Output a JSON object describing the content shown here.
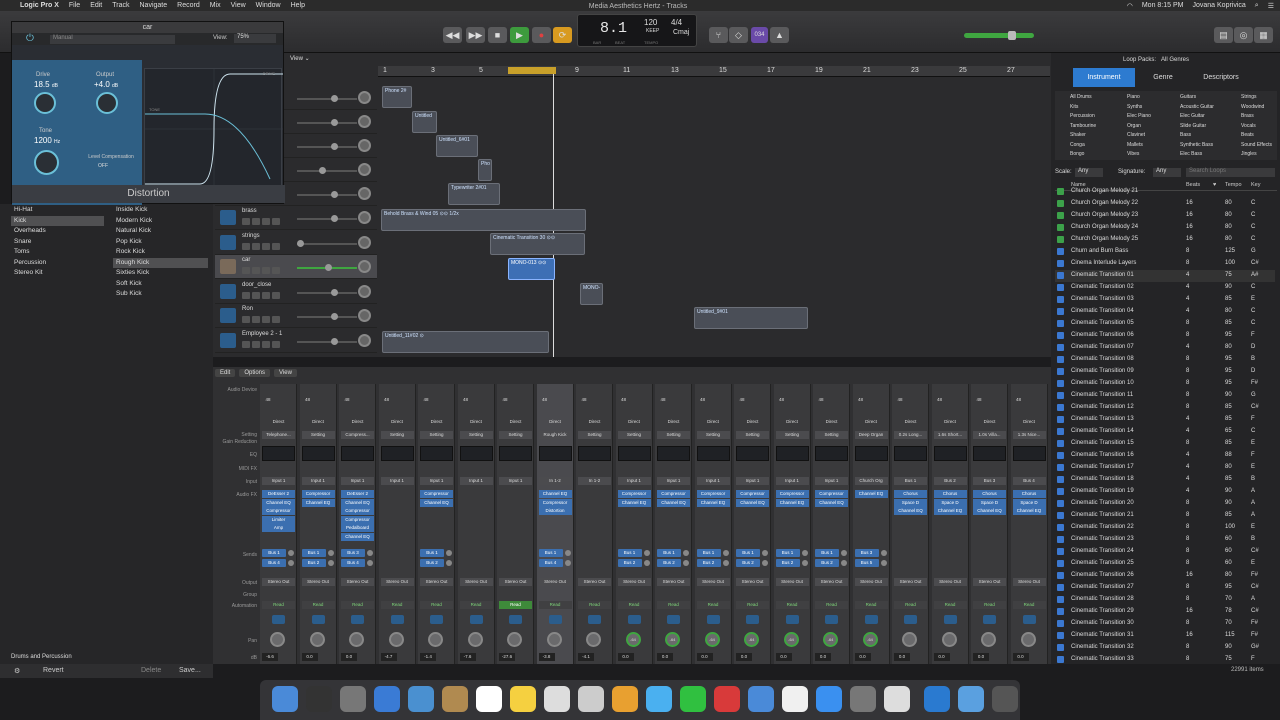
{
  "menubar": {
    "app": "Logic Pro X",
    "items": [
      "File",
      "Edit",
      "Track",
      "Navigate",
      "Record",
      "Mix",
      "View",
      "Window",
      "Help"
    ],
    "clock": "Mon 8:15 PM",
    "user": "Jovana Koprivica"
  },
  "lcd": {
    "title": "Media Aesthetics Hertz - Tracks",
    "position": "8.1",
    "tempo": "120",
    "tempo_sub": "KEEP",
    "signature": "4/4",
    "key": "Cmaj",
    "labels": [
      "BAR",
      "BEAT",
      "TEMPO"
    ]
  },
  "transport": {
    "rewind": "◀◀",
    "forward": "▶▶",
    "stop": "■",
    "play": "▶",
    "record": "●",
    "cycle": "⟳"
  },
  "toolbar_right": {
    "count": "034"
  },
  "plugin": {
    "title": "car",
    "preset": "Manual",
    "view_label": "View:",
    "view_value": "75%",
    "drive_label": "Drive",
    "drive_value": "18.5",
    "drive_unit": "dB",
    "output_label": "Output",
    "output_value": "+4.0",
    "output_unit": "dB",
    "tone_label": "Tone",
    "tone_value": "1200",
    "tone_unit": "Hz",
    "level_comp_label": "Level Compensation",
    "level_comp_value": "OFF",
    "graph_drive": "DRIVE",
    "graph_tone": "TONE",
    "name": "Distortion"
  },
  "tracks_toolbar": {
    "view": "View"
  },
  "ruler": [
    {
      "n": "1"
    },
    {
      "n": "3"
    },
    {
      "n": "5"
    },
    {
      "n": "7"
    },
    {
      "n": "9"
    },
    {
      "n": "11"
    },
    {
      "n": "13"
    },
    {
      "n": "15"
    },
    {
      "n": "17"
    },
    {
      "n": "19"
    },
    {
      "n": "21"
    },
    {
      "n": "23"
    },
    {
      "n": "25"
    },
    {
      "n": "27"
    }
  ],
  "tracks": [
    {
      "name": "",
      "pan": 0
    },
    {
      "name": "",
      "pan": 0
    },
    {
      "name": "",
      "pan": 0
    },
    {
      "name": "",
      "pan": 0
    },
    {
      "name": "",
      "pan": 0
    },
    {
      "name": "brass"
    },
    {
      "name": "strings"
    },
    {
      "name": "car"
    },
    {
      "name": "door_close"
    },
    {
      "name": "Ron"
    },
    {
      "name": "Employee 2 - 1"
    }
  ],
  "regions": [
    "Phone 2#",
    "Untitled",
    "Untitled_6#01",
    "Pho",
    "Typewriter 2#01",
    "Behold Brass & Wind 05 ⊙⊙ 1/2x",
    "Cinematic Transition 30 ⊙⊙",
    "MONO-013 ⊙⊙",
    "MONO-",
    "Untitled_9#01",
    "Untitled_11#02 ⊙"
  ],
  "library": {
    "col1": [
      "Hi-Hat",
      "Kick",
      "Overheads",
      "Snare",
      "Toms",
      "Percussion",
      "Stereo Kit"
    ],
    "col2": [
      "Inside Kick",
      "Modern Kick",
      "Natural Kick",
      "Pop Kick",
      "Rock Kick",
      "Rough Kick",
      "Sixties Kick",
      "Soft Kick",
      "Sub Kick"
    ],
    "footer": "Drums and Percussion",
    "revert": "Revert",
    "delete": "Delete",
    "save": "Save..."
  },
  "mixer": {
    "menu": [
      "Edit",
      "Options",
      "View"
    ],
    "row_labels": [
      "Audio Device",
      "Setting",
      "Gain Reduction",
      "EQ",
      "MIDI FX",
      "Input",
      "Audio FX",
      "Sends",
      "Output",
      "Group",
      "Automation",
      "Pan",
      "dB"
    ],
    "strips": [
      {
        "setting": "Telephone...",
        "input": "Input 1",
        "fx": [
          "DeEsser 2",
          "Channel EQ",
          "Compressor",
          "Limiter",
          "Amp"
        ],
        "sends": [
          "Bus 1",
          "Bus 4"
        ],
        "output": "Stereo Out",
        "auto": "Read",
        "db": "-6.6"
      },
      {
        "setting": "Setting",
        "input": "Input 1",
        "fx": [
          "Compressor",
          "Channel EQ"
        ],
        "sends": [
          "Bus 1",
          "Bus 2"
        ],
        "output": "Stereo Out",
        "auto": "Read",
        "db": "0.0"
      },
      {
        "setting": "Compress...",
        "input": "Input 1",
        "fx": [
          "DeEsser 2",
          "Channel EQ",
          "Compressor",
          "Compressor",
          "Pedalboard",
          "Channel EQ"
        ],
        "sends": [
          "Bus 3",
          "Bus 4"
        ],
        "output": "Stereo Out",
        "auto": "Read",
        "db": "0.0"
      },
      {
        "setting": "Setting",
        "input": "Input 1",
        "fx": [],
        "sends": [],
        "output": "Stereo Out",
        "auto": "Read",
        "db": "-4.7"
      },
      {
        "setting": "Setting",
        "input": "Input 1",
        "fx": [
          "Compressor",
          "Channel EQ"
        ],
        "sends": [
          "Bus 1",
          "Bus 2"
        ],
        "output": "Stereo Out",
        "auto": "Read",
        "db": "-1.4"
      },
      {
        "setting": "Setting",
        "input": "Input 1",
        "fx": [],
        "sends": [],
        "output": "Stereo Out",
        "auto": "Read",
        "db": "-7.6"
      },
      {
        "setting": "Setting",
        "input": "Input 1",
        "fx": [],
        "sends": [],
        "output": "Stereo Out",
        "auto": "Read",
        "db": "-27.6"
      },
      {
        "setting": "Rough Kick",
        "input": "In 1-2",
        "fx": [
          "Channel EQ",
          "Compressor",
          "Distortion"
        ],
        "sends": [
          "Bus 1",
          "Bus 4"
        ],
        "output": "Stereo Out",
        "auto": "Read",
        "db": "-3.8"
      },
      {
        "setting": "Setting",
        "input": "In 1-2",
        "fx": [],
        "sends": [],
        "output": "Stereo Out",
        "auto": "Read",
        "db": "-4.1"
      },
      {
        "setting": "Setting",
        "input": "Input 1",
        "fx": [
          "Compressor",
          "Channel EQ"
        ],
        "sends": [
          "Bus 1",
          "Bus 2"
        ],
        "output": "Stereo Out",
        "auto": "Read",
        "db": "0.0"
      },
      {
        "setting": "Setting",
        "input": "Input 1",
        "fx": [
          "Compressor",
          "Channel EQ"
        ],
        "sends": [
          "Bus 1",
          "Bus 2"
        ],
        "output": "Stereo Out",
        "auto": "Read",
        "db": "0.0"
      },
      {
        "setting": "Setting",
        "input": "Input 1",
        "fx": [
          "Compressor",
          "Channel EQ"
        ],
        "sends": [
          "Bus 1",
          "Bus 2"
        ],
        "output": "Stereo Out",
        "auto": "Read",
        "db": "0.0"
      },
      {
        "setting": "Setting",
        "input": "Input 1",
        "fx": [
          "Compressor",
          "Channel EQ"
        ],
        "sends": [
          "Bus 1",
          "Bus 2"
        ],
        "output": "Stereo Out",
        "auto": "Read",
        "db": "0.0"
      },
      {
        "setting": "Setting",
        "input": "Input 1",
        "fx": [
          "Compressor",
          "Channel EQ"
        ],
        "sends": [
          "Bus 1",
          "Bus 2"
        ],
        "output": "Stereo Out",
        "auto": "Read",
        "db": "0.0"
      },
      {
        "setting": "Setting",
        "input": "Input 1",
        "fx": [
          "Compressor",
          "Channel EQ"
        ],
        "sends": [
          "Bus 1",
          "Bus 2"
        ],
        "output": "Stereo Out",
        "auto": "Read",
        "db": "0.0"
      },
      {
        "setting": "Deep Organ",
        "input": "Church Org",
        "fx": [
          "Channel EQ"
        ],
        "sends": [
          "Bus 3",
          "Bus 5"
        ],
        "output": "Stereo Out",
        "auto": "Read",
        "db": "0.0"
      },
      {
        "setting": "0.2s Long...",
        "input": "Bus 1",
        "fx": [
          "Chorus",
          "Space D",
          "Channel EQ"
        ],
        "sends": [],
        "output": "Stereo Out",
        "auto": "Read",
        "db": "0.0"
      },
      {
        "setting": "1.6s Short...",
        "input": "Bus 2",
        "fx": [
          "Chorus",
          "Space D",
          "Channel EQ"
        ],
        "sends": [],
        "output": "Stereo Out",
        "auto": "Read",
        "db": "0.0"
      },
      {
        "setting": "1.0s Villa...",
        "input": "Bus 3",
        "fx": [
          "Chorus",
          "Space D",
          "Channel EQ"
        ],
        "sends": [],
        "output": "Stereo Out",
        "auto": "Read",
        "db": "0.0"
      },
      {
        "setting": "1.3s Nice...",
        "input": "Bus 4",
        "fx": [
          "Chorus",
          "Space D",
          "Channel EQ"
        ],
        "sends": [],
        "output": "Stereo Out",
        "auto": "Read",
        "db": "0.0"
      }
    ],
    "direct": "Direct",
    "pan_val": "-64",
    "hp": "48"
  },
  "browser": {
    "loop_packs_label": "Loop Packs:",
    "loop_packs_value": "All Genres",
    "tabs": [
      "Instrument",
      "Genre",
      "Descriptors"
    ],
    "grid": [
      [
        "All Drums",
        "Piano",
        "Guitars",
        "Strings"
      ],
      [
        "Kits",
        "Synths",
        "Acoustic Guitar",
        "Woodwind"
      ],
      [
        "Percussion",
        "Elec Piano",
        "Elec Guitar",
        "Brass"
      ],
      [
        "Tambourine",
        "Organ",
        "Slide Guitar",
        "Vocals"
      ],
      [
        "Shaker",
        "Clavinet",
        "Bass",
        "Beats"
      ],
      [
        "Conga",
        "Mallets",
        "Synthetic Bass",
        "Sound Effects"
      ],
      [
        "Bongo",
        "Vibes",
        "Elec Bass",
        "Jingles"
      ]
    ],
    "scale_label": "Scale:",
    "scale_value": "Any",
    "sig_label": "Signature:",
    "sig_value": "Any",
    "search_placeholder": "Search Loops",
    "cols": {
      "name": "Name",
      "beats": "Beats",
      "tempo": "Tempo",
      "key": "Key"
    },
    "rows": [
      {
        "n": "Church Organ Melody 21",
        "b": "",
        "t": "",
        "k": "",
        "g": true
      },
      {
        "n": "Church Organ Melody 22",
        "b": "16",
        "t": "80",
        "k": "C",
        "g": true
      },
      {
        "n": "Church Organ Melody 23",
        "b": "16",
        "t": "80",
        "k": "C",
        "g": true
      },
      {
        "n": "Church Organ Melody 24",
        "b": "16",
        "t": "80",
        "k": "C",
        "g": true
      },
      {
        "n": "Church Organ Melody 25",
        "b": "16",
        "t": "80",
        "k": "C",
        "g": true
      },
      {
        "n": "Churn and Burn Bass",
        "b": "8",
        "t": "125",
        "k": "G"
      },
      {
        "n": "Cinema Interlude Layers",
        "b": "8",
        "t": "100",
        "k": "C#"
      },
      {
        "n": "Cinematic Transition 01",
        "b": "4",
        "t": "75",
        "k": "A#"
      },
      {
        "n": "Cinematic Transition 02",
        "b": "4",
        "t": "90",
        "k": "C"
      },
      {
        "n": "Cinematic Transition 03",
        "b": "4",
        "t": "85",
        "k": "E"
      },
      {
        "n": "Cinematic Transition 04",
        "b": "4",
        "t": "80",
        "k": "C"
      },
      {
        "n": "Cinematic Transition 05",
        "b": "8",
        "t": "85",
        "k": "C"
      },
      {
        "n": "Cinematic Transition 06",
        "b": "8",
        "t": "95",
        "k": "F"
      },
      {
        "n": "Cinematic Transition 07",
        "b": "4",
        "t": "80",
        "k": "D"
      },
      {
        "n": "Cinematic Transition 08",
        "b": "8",
        "t": "95",
        "k": "B"
      },
      {
        "n": "Cinematic Transition 09",
        "b": "8",
        "t": "95",
        "k": "D"
      },
      {
        "n": "Cinematic Transition 10",
        "b": "8",
        "t": "95",
        "k": "F#"
      },
      {
        "n": "Cinematic Transition 11",
        "b": "8",
        "t": "90",
        "k": "G"
      },
      {
        "n": "Cinematic Transition 12",
        "b": "8",
        "t": "85",
        "k": "C#"
      },
      {
        "n": "Cinematic Transition 13",
        "b": "4",
        "t": "85",
        "k": "F"
      },
      {
        "n": "Cinematic Transition 14",
        "b": "4",
        "t": "65",
        "k": "C"
      },
      {
        "n": "Cinematic Transition 15",
        "b": "8",
        "t": "85",
        "k": "E"
      },
      {
        "n": "Cinematic Transition 16",
        "b": "4",
        "t": "88",
        "k": "F"
      },
      {
        "n": "Cinematic Transition 17",
        "b": "4",
        "t": "80",
        "k": "E"
      },
      {
        "n": "Cinematic Transition 18",
        "b": "4",
        "t": "85",
        "k": "B"
      },
      {
        "n": "Cinematic Transition 19",
        "b": "4",
        "t": "90",
        "k": "A"
      },
      {
        "n": "Cinematic Transition 20",
        "b": "8",
        "t": "90",
        "k": "A"
      },
      {
        "n": "Cinematic Transition 21",
        "b": "8",
        "t": "85",
        "k": "A"
      },
      {
        "n": "Cinematic Transition 22",
        "b": "8",
        "t": "100",
        "k": "E"
      },
      {
        "n": "Cinematic Transition 23",
        "b": "8",
        "t": "60",
        "k": "B"
      },
      {
        "n": "Cinematic Transition 24",
        "b": "8",
        "t": "60",
        "k": "C#"
      },
      {
        "n": "Cinematic Transition 25",
        "b": "8",
        "t": "60",
        "k": "E"
      },
      {
        "n": "Cinematic Transition 26",
        "b": "16",
        "t": "80",
        "k": "F#"
      },
      {
        "n": "Cinematic Transition 27",
        "b": "8",
        "t": "95",
        "k": "C#"
      },
      {
        "n": "Cinematic Transition 28",
        "b": "8",
        "t": "70",
        "k": "A"
      },
      {
        "n": "Cinematic Transition 29",
        "b": "16",
        "t": "78",
        "k": "C#"
      },
      {
        "n": "Cinematic Transition 30",
        "b": "8",
        "t": "70",
        "k": "F#"
      },
      {
        "n": "Cinematic Transition 31",
        "b": "16",
        "t": "115",
        "k": "F#"
      },
      {
        "n": "Cinematic Transition 32",
        "b": "8",
        "t": "90",
        "k": "G#"
      },
      {
        "n": "Cinematic Transition 33",
        "b": "8",
        "t": "75",
        "k": "F"
      }
    ],
    "count": "22991 items"
  }
}
